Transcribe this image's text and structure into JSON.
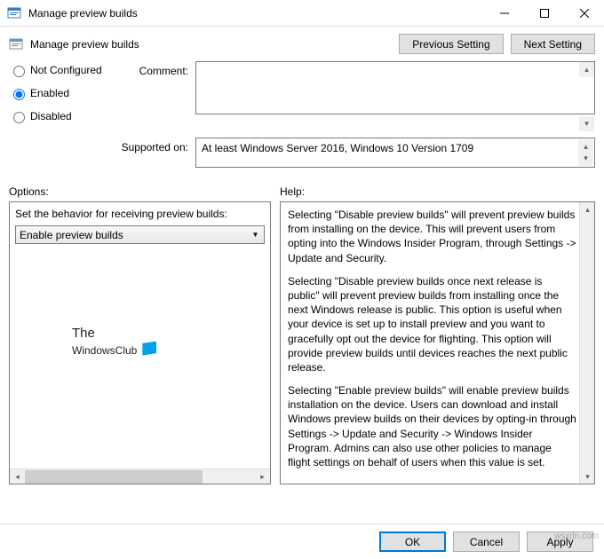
{
  "window": {
    "title": "Manage preview builds",
    "min_icon": "—",
    "max_icon": "☐",
    "close_icon": "✕"
  },
  "header": {
    "title": "Manage preview builds",
    "prev_button": "Previous Setting",
    "next_button": "Next Setting"
  },
  "radios": {
    "not_configured": "Not Configured",
    "enabled": "Enabled",
    "disabled": "Disabled",
    "selected": "enabled"
  },
  "labels": {
    "comment": "Comment:",
    "supported": "Supported on:",
    "options": "Options:",
    "help": "Help:"
  },
  "comment_value": "",
  "supported_value": "At least Windows Server 2016, Windows 10 Version 1709",
  "options_panel": {
    "behavior_label": "Set the behavior for receiving preview builds:",
    "dropdown_value": "Enable preview builds"
  },
  "help_text": {
    "p1": "Selecting \"Disable preview builds\" will prevent preview builds from installing on the device. This will prevent users from opting into the Windows Insider Program, through Settings -> Update and Security.",
    "p2": "Selecting \"Disable preview builds once next release is public\" will prevent preview builds from installing once the next Windows release is public. This option is useful when your device is set up to install preview and you want to gracefully opt out the device for flighting. This option will provide preview builds until devices reaches the next public release.",
    "p3": "Selecting \"Enable preview builds\" will enable preview builds installation on the device. Users can download and install Windows preview builds on their devices by opting-in through Settings -> Update and Security -> Windows Insider Program. Admins can also use other policies to manage flight settings on behalf of users when this value is set."
  },
  "watermark": {
    "line1": "The",
    "line2": "WindowsClub"
  },
  "footer": {
    "ok": "OK",
    "cancel": "Cancel",
    "apply": "Apply"
  },
  "source_tag": "wsxdn.com"
}
